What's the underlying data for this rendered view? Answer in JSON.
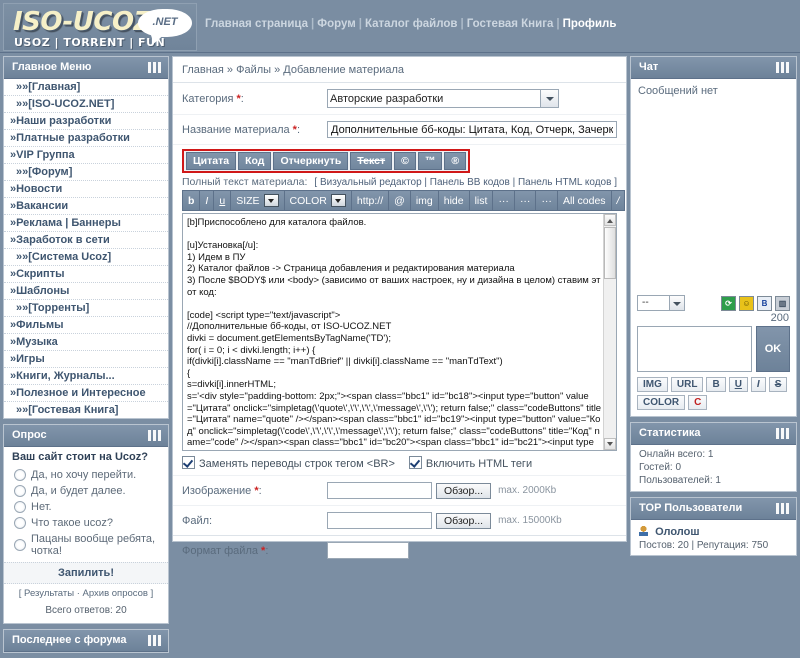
{
  "header": {
    "logo_main": "ISO-UCOZ",
    "logo_sub": "USOZ | TORRENT | FUN",
    "logo_badge": ".NET",
    "nav": [
      {
        "label": "Главная страница",
        "current": false
      },
      {
        "label": "Форум",
        "current": false
      },
      {
        "label": "Каталог файлов",
        "current": false
      },
      {
        "label": "Гостевая Книга",
        "current": false
      },
      {
        "label": "Профиль",
        "current": true
      }
    ],
    "separator": "|"
  },
  "sidebar_left": {
    "menu": {
      "title": "Главное Меню",
      "items": [
        {
          "label": "»»[Главная]",
          "sub": true
        },
        {
          "label": "»»[ISO-UCOZ.NET]",
          "sub": true
        },
        {
          "label": "»Наши разработки",
          "sub": false
        },
        {
          "label": "»Платные разработки",
          "sub": false
        },
        {
          "label": "»VIP Группа",
          "sub": false
        },
        {
          "label": "»»[Форум]",
          "sub": true
        },
        {
          "label": "»Новости",
          "sub": false
        },
        {
          "label": "»Вакансии",
          "sub": false
        },
        {
          "label": "»Реклама | Баннеры",
          "sub": false
        },
        {
          "label": "»Заработок в сети",
          "sub": false
        },
        {
          "label": "»»[Система Ucoz]",
          "sub": true
        },
        {
          "label": "»Скрипты",
          "sub": false
        },
        {
          "label": "»Шаблоны",
          "sub": false
        },
        {
          "label": "»»[Торренты]",
          "sub": true
        },
        {
          "label": "»Фильмы",
          "sub": false
        },
        {
          "label": "»Музыка",
          "sub": false
        },
        {
          "label": "»Игры",
          "sub": false
        },
        {
          "label": "»Книги, Журналы...",
          "sub": false
        },
        {
          "label": "»Полезное и Интересное",
          "sub": false
        },
        {
          "label": "»»[Гостевая Книга]",
          "sub": true
        }
      ]
    },
    "poll": {
      "title": "Опрос",
      "question": "Ваш сайт стоит на Ucoz?",
      "options": [
        "Да, но хочу перейти.",
        "Да, и будет далее.",
        "Нет.",
        "Что такое ucoz?",
        "Пацаны вообще ребята, чотка!"
      ],
      "submit_label": "Запилить!",
      "links": "[ Результаты · Архив опросов ]",
      "total": "Всего ответов: 20"
    },
    "forum": {
      "title": "Последнее с форума"
    }
  },
  "main": {
    "breadcrumb": "Главная » Файлы » Добавление материала",
    "category": {
      "label": "Категория",
      "required": "*",
      "value": "Авторские разработки"
    },
    "title_field": {
      "label": "Название материала",
      "required": "*",
      "value": "Дополнительные бб-коды: Цитата, Код, Отчерк, Зачеркнутый текст"
    },
    "bb_extra_buttons": [
      {
        "label": "Цитата",
        "strike": false
      },
      {
        "label": "Код",
        "strike": false
      },
      {
        "label": "Отчеркнуть",
        "strike": false
      },
      {
        "label": "Текст",
        "strike": true
      },
      {
        "label": "©",
        "strike": false
      },
      {
        "label": "™",
        "strike": false
      },
      {
        "label": "®",
        "strike": false
      }
    ],
    "fulltext_label": "Полный текст материала:",
    "editor_links": "[ Визуальный редактор | Панель BB кодов | Панель HTML кодов ]",
    "toolbar": [
      {
        "label": "b",
        "style": "b",
        "dropdown": false
      },
      {
        "label": "I",
        "style": "i",
        "dropdown": false
      },
      {
        "label": "u",
        "style": "u",
        "dropdown": false
      },
      {
        "label": "SIZE",
        "style": "",
        "dropdown": true
      },
      {
        "label": "COLOR",
        "style": "",
        "dropdown": true
      },
      {
        "label": "http://",
        "style": "",
        "dropdown": false
      },
      {
        "label": "@",
        "style": "",
        "dropdown": false
      },
      {
        "label": "img",
        "style": "",
        "dropdown": false
      },
      {
        "label": "hide",
        "style": "",
        "dropdown": false
      },
      {
        "label": "list",
        "style": "",
        "dropdown": false
      },
      {
        "label": "···",
        "style": "",
        "dropdown": false
      },
      {
        "label": "···",
        "style": "",
        "dropdown": false
      },
      {
        "label": "···",
        "style": "",
        "dropdown": false
      },
      {
        "label": "All codes",
        "style": "",
        "dropdown": false
      },
      {
        "label": "/",
        "style": "i",
        "dropdown": false
      }
    ],
    "textarea_value": "[b]Приспособлено для каталога файлов.\n\n[u]Установка[/u]:\n1) Идем в ПУ\n2) Каталог файлов -> Страница добавления и редактирования материала\n3) После $BODY$ или <body> (зависимо от ваших настроек, ну и дизайна в целом) ставим этот код:\n\n[code] <script type=\"text/javascript\">\n//Дополнительные бб-коды, от ISO-UCOZ.NET\ndivki = document.getElementsByTagName('TD');\nfor( i = 0; i < divki.length; i++) {\nif(divki[i].className == \"manTdBrief\" || divki[i].className == \"manTdText\")\n{\ns=divki[i].innerHTML;\ns='<div style=\"padding-bottom: 2px;\"><span class=\"bbc1\" id=\"bc18\"><input type=\"button\" value=\"Цитата\" onclick=\"simpletag(\\'quote\\',\\'\\',\\'\\',\\'message\\',\\'\\'); return false;\" class=\"codeButtons\" title=\"Цитата\" name=\"quote\" /></span><span class=\"bbc1\" id=\"bc19\"><input type=\"button\" value=\"Код\" onclick=\"simpletag(\\'code\\',\\'\\',\\'\\',\\'message\\',\\'\\'); return false;\" class=\"codeButtons\" title=\"Код\" name=\"code\" /></span><span class=\"bbc1\" id=\"bc20\"><span class=\"bbc1\" id=\"bc21\"><input type=\"button\" value=\"Отчеркнуть\" onclick=\"emoticon(\\'[hr]\\');return false;\" class=\"codeButtons\" title=\"Отчеркнуть текст, тег hr\" name=\"hr\" /></span><span class=\"bbc1\" id=\"bc27\"><input type=\"button\" value=\"Текст\" style=\"text-decoration: line-through;\" onclick=\"simpletag(\\'s\\',\\'\\',\\'\\',\\'message\\',\\'\\'); return false;\" class=\"codeButtons\" title=\"Зачеркнутый текст\" name=\"s\" /></span><span class=\"bbc1\" id=\"bc29\"><input",
    "checkboxes": [
      {
        "label": "Заменять переводы строк тегом <BR>",
        "checked": true
      },
      {
        "label": "Включить HTML теги",
        "checked": true
      }
    ],
    "image_field": {
      "label": "Изображение",
      "required": "*",
      "browse": "Обзор...",
      "max": "max. 2000Кb"
    },
    "file_field": {
      "label": "Файл",
      "required": "",
      "browse": "Обзор...",
      "max": "max. 15000Кb"
    },
    "format_field": {
      "label": "Формат файла",
      "required": "*",
      "value": ""
    }
  },
  "sidebar_right": {
    "chat": {
      "title": "Чат",
      "empty_text": "Сообщений нет",
      "select_value": "--",
      "icons": [
        {
          "name": "refresh-icon",
          "glyph": "⟳"
        },
        {
          "name": "smiley-icon",
          "glyph": "☺"
        },
        {
          "name": "bold-icon",
          "glyph": "B"
        },
        {
          "name": "door-icon",
          "glyph": "▥"
        }
      ],
      "char_count": "200",
      "ok_label": "OK",
      "bb_buttons": [
        "IMG",
        "URL",
        "B",
        "U",
        "I",
        "S",
        "COLOR",
        "C"
      ]
    },
    "stats": {
      "title": "Статистика",
      "lines": [
        "Онлайн всего: 1",
        "Гостей: 0",
        "Пользователей: 1"
      ]
    },
    "top_users": {
      "title": "TOP Пользователи",
      "user_name": "Ололош",
      "user_meta": "Постов: 20 | Репутация: 750"
    }
  }
}
